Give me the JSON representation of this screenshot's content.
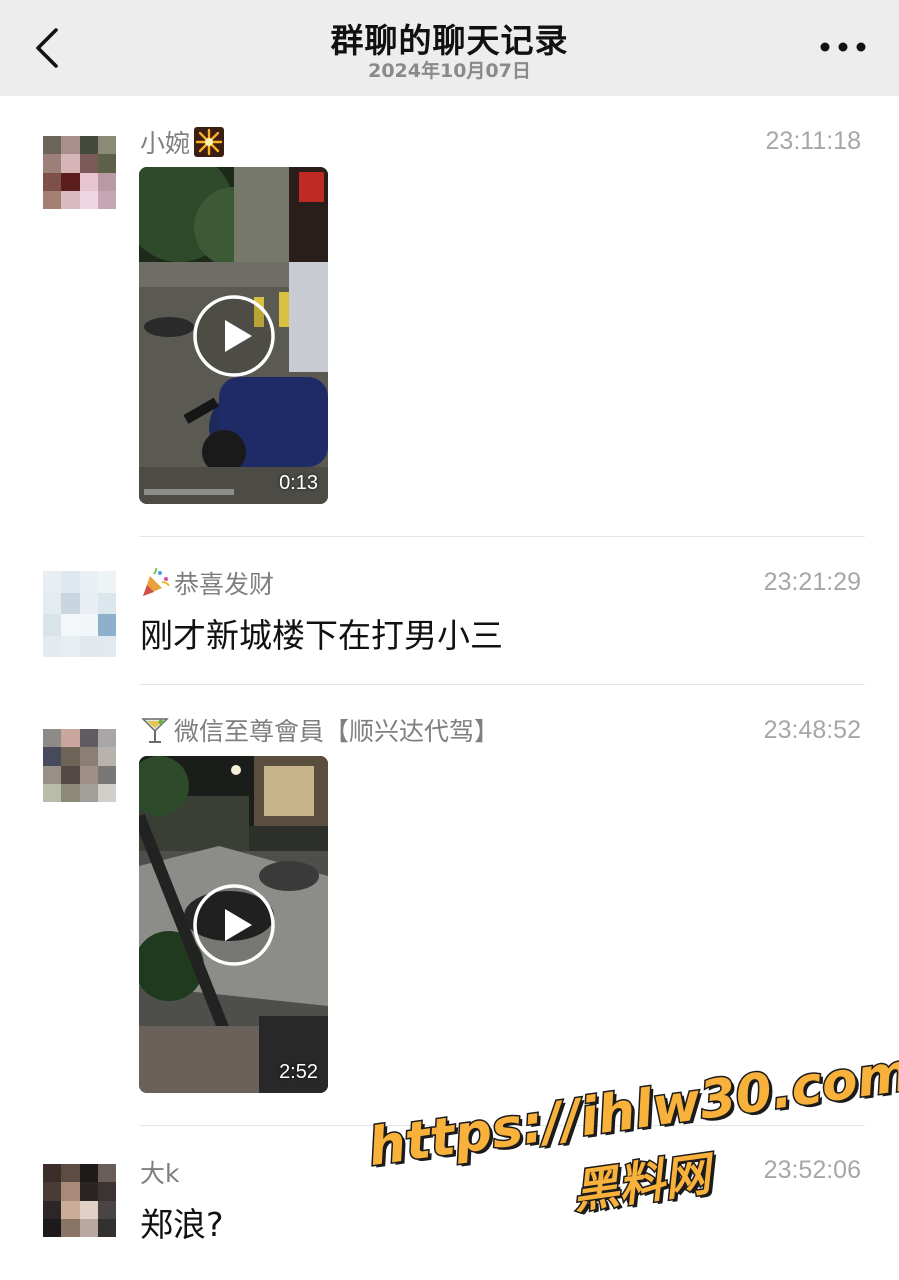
{
  "header": {
    "title": "群聊的聊天记录",
    "date": "2024年10月07日"
  },
  "messages": [
    {
      "sender": "小婉",
      "emoji": "firework-icon",
      "time": "23:11:18",
      "type": "video",
      "duration": "0:13"
    },
    {
      "sender": "恭喜发财",
      "emoji": "party-popper-icon",
      "time": "23:21:29",
      "type": "text",
      "text": "刚才新城楼下在打男小三"
    },
    {
      "sender": "微信至尊會員【顺兴达代驾】",
      "emoji": "cocktail-icon",
      "time": "23:48:52",
      "type": "video",
      "duration": "2:52"
    },
    {
      "sender": "大k",
      "time": "23:52:06",
      "type": "text",
      "text": "郑浪?"
    }
  ],
  "watermark": {
    "url": "https://ihlw30.com",
    "name": "黑料网"
  },
  "colors": {
    "header_bg": "#ededed",
    "time": "#a7a7a7",
    "sender": "#7f7f7f",
    "watermark": "#f8b13a"
  }
}
